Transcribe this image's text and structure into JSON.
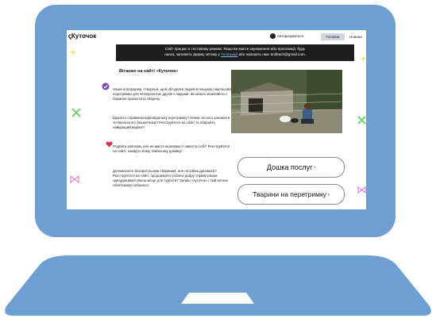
{
  "site": {
    "logo": "ꞔКуточок",
    "auth_label": "Авторизуватися",
    "nav": {
      "main": "Головна",
      "new": "Новини"
    }
  },
  "notice": {
    "line1": "Сайт працює в тестовому режимі. Якщо ви маєте зауваження або пропозиції, будь",
    "line2_prefix": "ласка, заповніть форму зв'язку у",
    "line2_link": "Телеграмі",
    "line2_suffix": "або напишіть нам: knifeach@gmail.com."
  },
  "content": {
    "welcome": "Вітаємо на сайті «Куточок»",
    "p1": "Наша платформа, створена, щоб об'єднати людей в пошуках тимчасової перетримки для четвероногих друзів з людьми, які мають можливість і бажання прихистити тварину.",
    "p2": "Шукаєте справжню відповідальну перетримку? Немає на кого залишити четвероногого бешкетника? Реєструйтеся на сайті та обирайте найкращий варіант!",
    "p3": "Подбати звіяткам, але не маєте можливості завести собі? Реєструйтеся на сайті, знайдіть йому тимчасову домівку!",
    "p4": "Допомагаєте безпритульним тваринам, але потрібна допомога? Реєструйтеся на сайті, продовжуйте робити добру справу разом однодумцями! Маєш місце для турботи? Залиш «хуточок» і твій вогник обов'язково побачать!"
  },
  "buttons": {
    "services": "Дошка послуг",
    "animals": "Тварини на перетримку"
  },
  "colors": {
    "laptop": "#6e9fd3",
    "notice_bg": "#1e1e1e",
    "accent": "#7b3fbf"
  }
}
